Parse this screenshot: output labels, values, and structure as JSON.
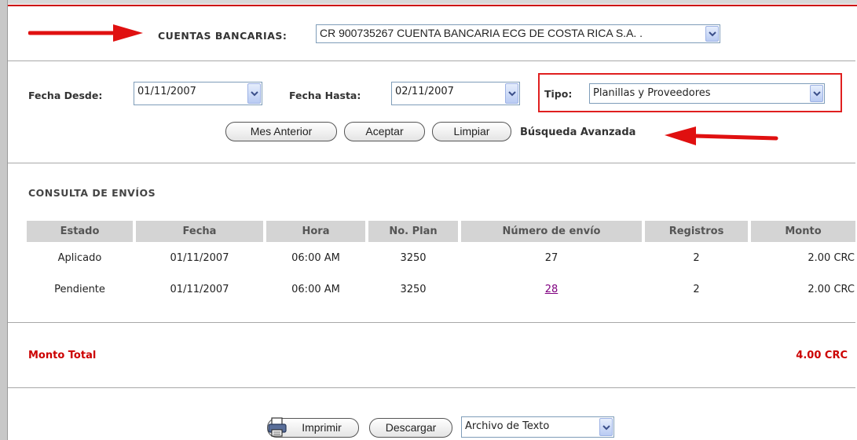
{
  "account": {
    "label": "CUENTAS BANCARIAS:",
    "selected": "CR 900735267 CUENTA BANCARIA ECG DE COSTA RICA S.A. ."
  },
  "filters": {
    "fecha_desde_label": "Fecha Desde:",
    "fecha_desde_value": "01/11/2007",
    "fecha_hasta_label": "Fecha Hasta:",
    "fecha_hasta_value": "02/11/2007",
    "tipo_label": "Tipo:",
    "tipo_value": "Planillas y Proveedores"
  },
  "actions": {
    "mes_anterior": "Mes Anterior",
    "aceptar": "Aceptar",
    "limpiar": "Limpiar",
    "busqueda_avanzada": "Búsqueda Avanzada"
  },
  "section_title": "CONSULTA DE ENVÍOS",
  "table": {
    "columns": [
      "Estado",
      "Fecha",
      "Hora",
      "No. Plan",
      "Número de envío",
      "Registros",
      "Monto"
    ],
    "rows": [
      {
        "estado": "Aplicado",
        "fecha": "01/11/2007",
        "hora": "06:00 AM",
        "plan": "3250",
        "envio": "27",
        "registros": "2",
        "monto": "2.00 CRC"
      },
      {
        "estado": "Pendiente",
        "fecha": "01/11/2007",
        "hora": "06:00 AM",
        "plan": "3250",
        "envio": "28",
        "registros": "2",
        "monto": "2.00 CRC"
      }
    ]
  },
  "total": {
    "label": "Monto Total",
    "value": "4.00 CRC"
  },
  "footer": {
    "imprimir": "Imprimir",
    "descargar": "Descargar",
    "formato": "Archivo de Texto"
  },
  "colors": {
    "accent_red": "#cc0000",
    "header_gray": "#d4d4d4",
    "link_purple": "#800080"
  }
}
